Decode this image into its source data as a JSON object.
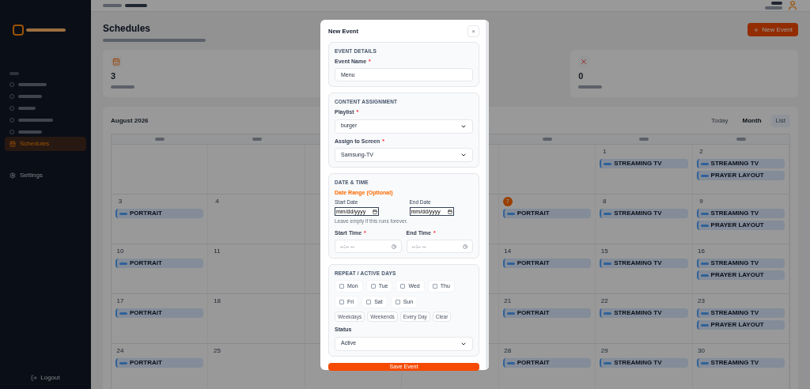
{
  "sidebar": {
    "items": [
      {
        "label": "Schedules",
        "selected": true
      },
      {
        "label": "Settings",
        "selected": false
      }
    ],
    "logout": "Logout"
  },
  "page": {
    "title": "Schedules",
    "new_button": "New Event"
  },
  "stats": [
    {
      "value": "3",
      "kind": "calendar"
    },
    {
      "value": "0",
      "kind": "rejected"
    }
  ],
  "calendar": {
    "title": "August 2026",
    "today_button": "Today",
    "views": [
      {
        "label": "Month",
        "selected": true
      },
      {
        "label": "List",
        "selected": false
      }
    ],
    "weeks": [
      {
        "column_6": {
          "date": "1",
          "today": false,
          "events": [
            {
              "title": "STREAMING TV"
            }
          ]
        },
        "column_7": {
          "date": "2",
          "today": false,
          "events": [
            {
              "title": "STREAMING TV"
            },
            {
              "title": "PRAYER LAYOUT"
            }
          ]
        }
      },
      {
        "column_1": {
          "date": "3",
          "today": false,
          "events": [
            {
              "title": "PORTRAIT"
            }
          ]
        },
        "column_2": {
          "date": "4",
          "today": false
        },
        "column_5": {
          "date": "7",
          "today": true,
          "events": [
            {
              "title": "PORTRAIT"
            }
          ]
        },
        "column_6": {
          "date": "8",
          "today": false,
          "events": [
            {
              "title": "STREAMING TV"
            }
          ]
        },
        "column_7": {
          "date": "9",
          "today": false,
          "events": [
            {
              "title": "STREAMING TV"
            },
            {
              "title": "PRAYER LAYOUT"
            }
          ]
        }
      },
      {
        "column_1": {
          "date": "10",
          "today": false,
          "events": [
            {
              "title": "PORTRAIT"
            }
          ]
        },
        "column_2": {
          "date": "11",
          "today": false
        },
        "column_5": {
          "date": "14",
          "today": false,
          "events": [
            {
              "title": "PORTRAIT"
            }
          ]
        },
        "column_6": {
          "date": "15",
          "today": false,
          "events": [
            {
              "title": "STREAMING TV"
            }
          ]
        },
        "column_7": {
          "date": "16",
          "today": false,
          "events": [
            {
              "title": "STREAMING TV"
            },
            {
              "title": "PRAYER LAYOUT"
            }
          ]
        }
      },
      {
        "column_1": {
          "date": "17",
          "today": false,
          "events": [
            {
              "title": "PORTRAIT"
            }
          ]
        },
        "column_2": {
          "date": "18",
          "today": false
        },
        "column_5": {
          "date": "21",
          "today": false,
          "events": [
            {
              "title": "PORTRAIT"
            }
          ]
        },
        "column_6": {
          "date": "22",
          "today": false,
          "events": [
            {
              "title": "STREAMING TV"
            }
          ]
        },
        "column_7": {
          "date": "23",
          "today": false,
          "events": [
            {
              "title": "STREAMING TV"
            },
            {
              "title": "PRAYER LAYOUT"
            }
          ]
        }
      },
      {
        "column_1": {
          "date": "24",
          "today": false,
          "events": [
            {
              "title": "PORTRAIT"
            }
          ]
        },
        "column_2": {
          "date": "25",
          "today": false
        },
        "column_5": {
          "date": "28",
          "today": false,
          "events": [
            {
              "title": "PORTRAIT"
            }
          ]
        },
        "column_6": {
          "date": "29",
          "today": false,
          "events": [
            {
              "title": "STREAMING TV"
            }
          ]
        },
        "column_7": {
          "date": "30",
          "today": false,
          "events": [
            {
              "title": "STREAMING TV"
            }
          ]
        }
      }
    ]
  },
  "modal": {
    "title": "New Event",
    "close": "×",
    "event_details": {
      "heading": "EVENT DETAILS",
      "name": {
        "label": "Event Name",
        "mark": "*",
        "value": "Menu"
      }
    },
    "content_assignment": {
      "heading": "CONTENT ASSIGNMENT",
      "playlist": {
        "label": "Playlist",
        "mark": "*",
        "value": "burger"
      },
      "screen": {
        "label": "Assign to Screen",
        "mark": "*",
        "value": "Samsung-TV"
      }
    },
    "date_time": {
      "heading": "DATE & TIME",
      "range_label": "Date Range (Optional)",
      "start_date": {
        "label": "Start Date",
        "placeholder": "mm/dd/yyyy"
      },
      "end_date": {
        "label": "End Date",
        "placeholder": "mm/dd/yyyy"
      },
      "hint": "Leave empty if this runs forever.",
      "start_time": {
        "label": "Start Time",
        "mark": "*",
        "placeholder": "--:-- --"
      },
      "end_time": {
        "label": "End Time",
        "mark": "*",
        "placeholder": "--:-- --"
      }
    },
    "repeat": {
      "heading": "REPEAT / ACTIVE DAYS",
      "days": [
        {
          "label": "Mon",
          "checked": false
        },
        {
          "label": "Tue",
          "checked": false
        },
        {
          "label": "Wed",
          "checked": false
        },
        {
          "label": "Thu",
          "checked": false
        },
        {
          "label": "Fri",
          "checked": false
        },
        {
          "label": "Sat",
          "checked": false
        },
        {
          "label": "Sun",
          "checked": false
        }
      ],
      "presets": [
        "Weekdays",
        "Weekends",
        "Every Day",
        "Clear"
      ],
      "status": {
        "label": "Status",
        "value": "Active"
      }
    },
    "save_button": "Save Event"
  }
}
